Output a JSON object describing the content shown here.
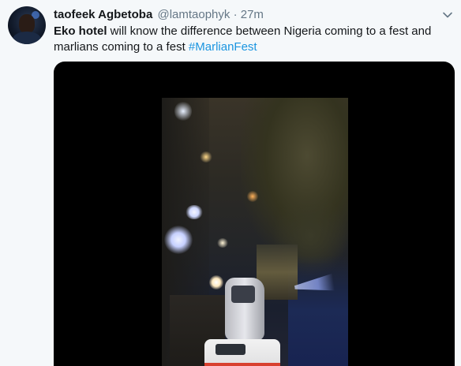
{
  "tweet": {
    "author_name": "taofeek Agbetoba",
    "author_handle": "@lamtaophyk",
    "separator": "·",
    "timestamp": "27m",
    "text_bold": "Eko hotel",
    "text_body": " will know the difference between Nigeria coming to a fest and marlians coming to a fest ",
    "hashtag": "#MarlianFest",
    "caret_icon": "chevron-down-icon"
  },
  "colors": {
    "background": "#f5f8fa",
    "text": "#14171a",
    "muted": "#657786",
    "link": "#1b95e0",
    "media_bg": "#000000"
  }
}
